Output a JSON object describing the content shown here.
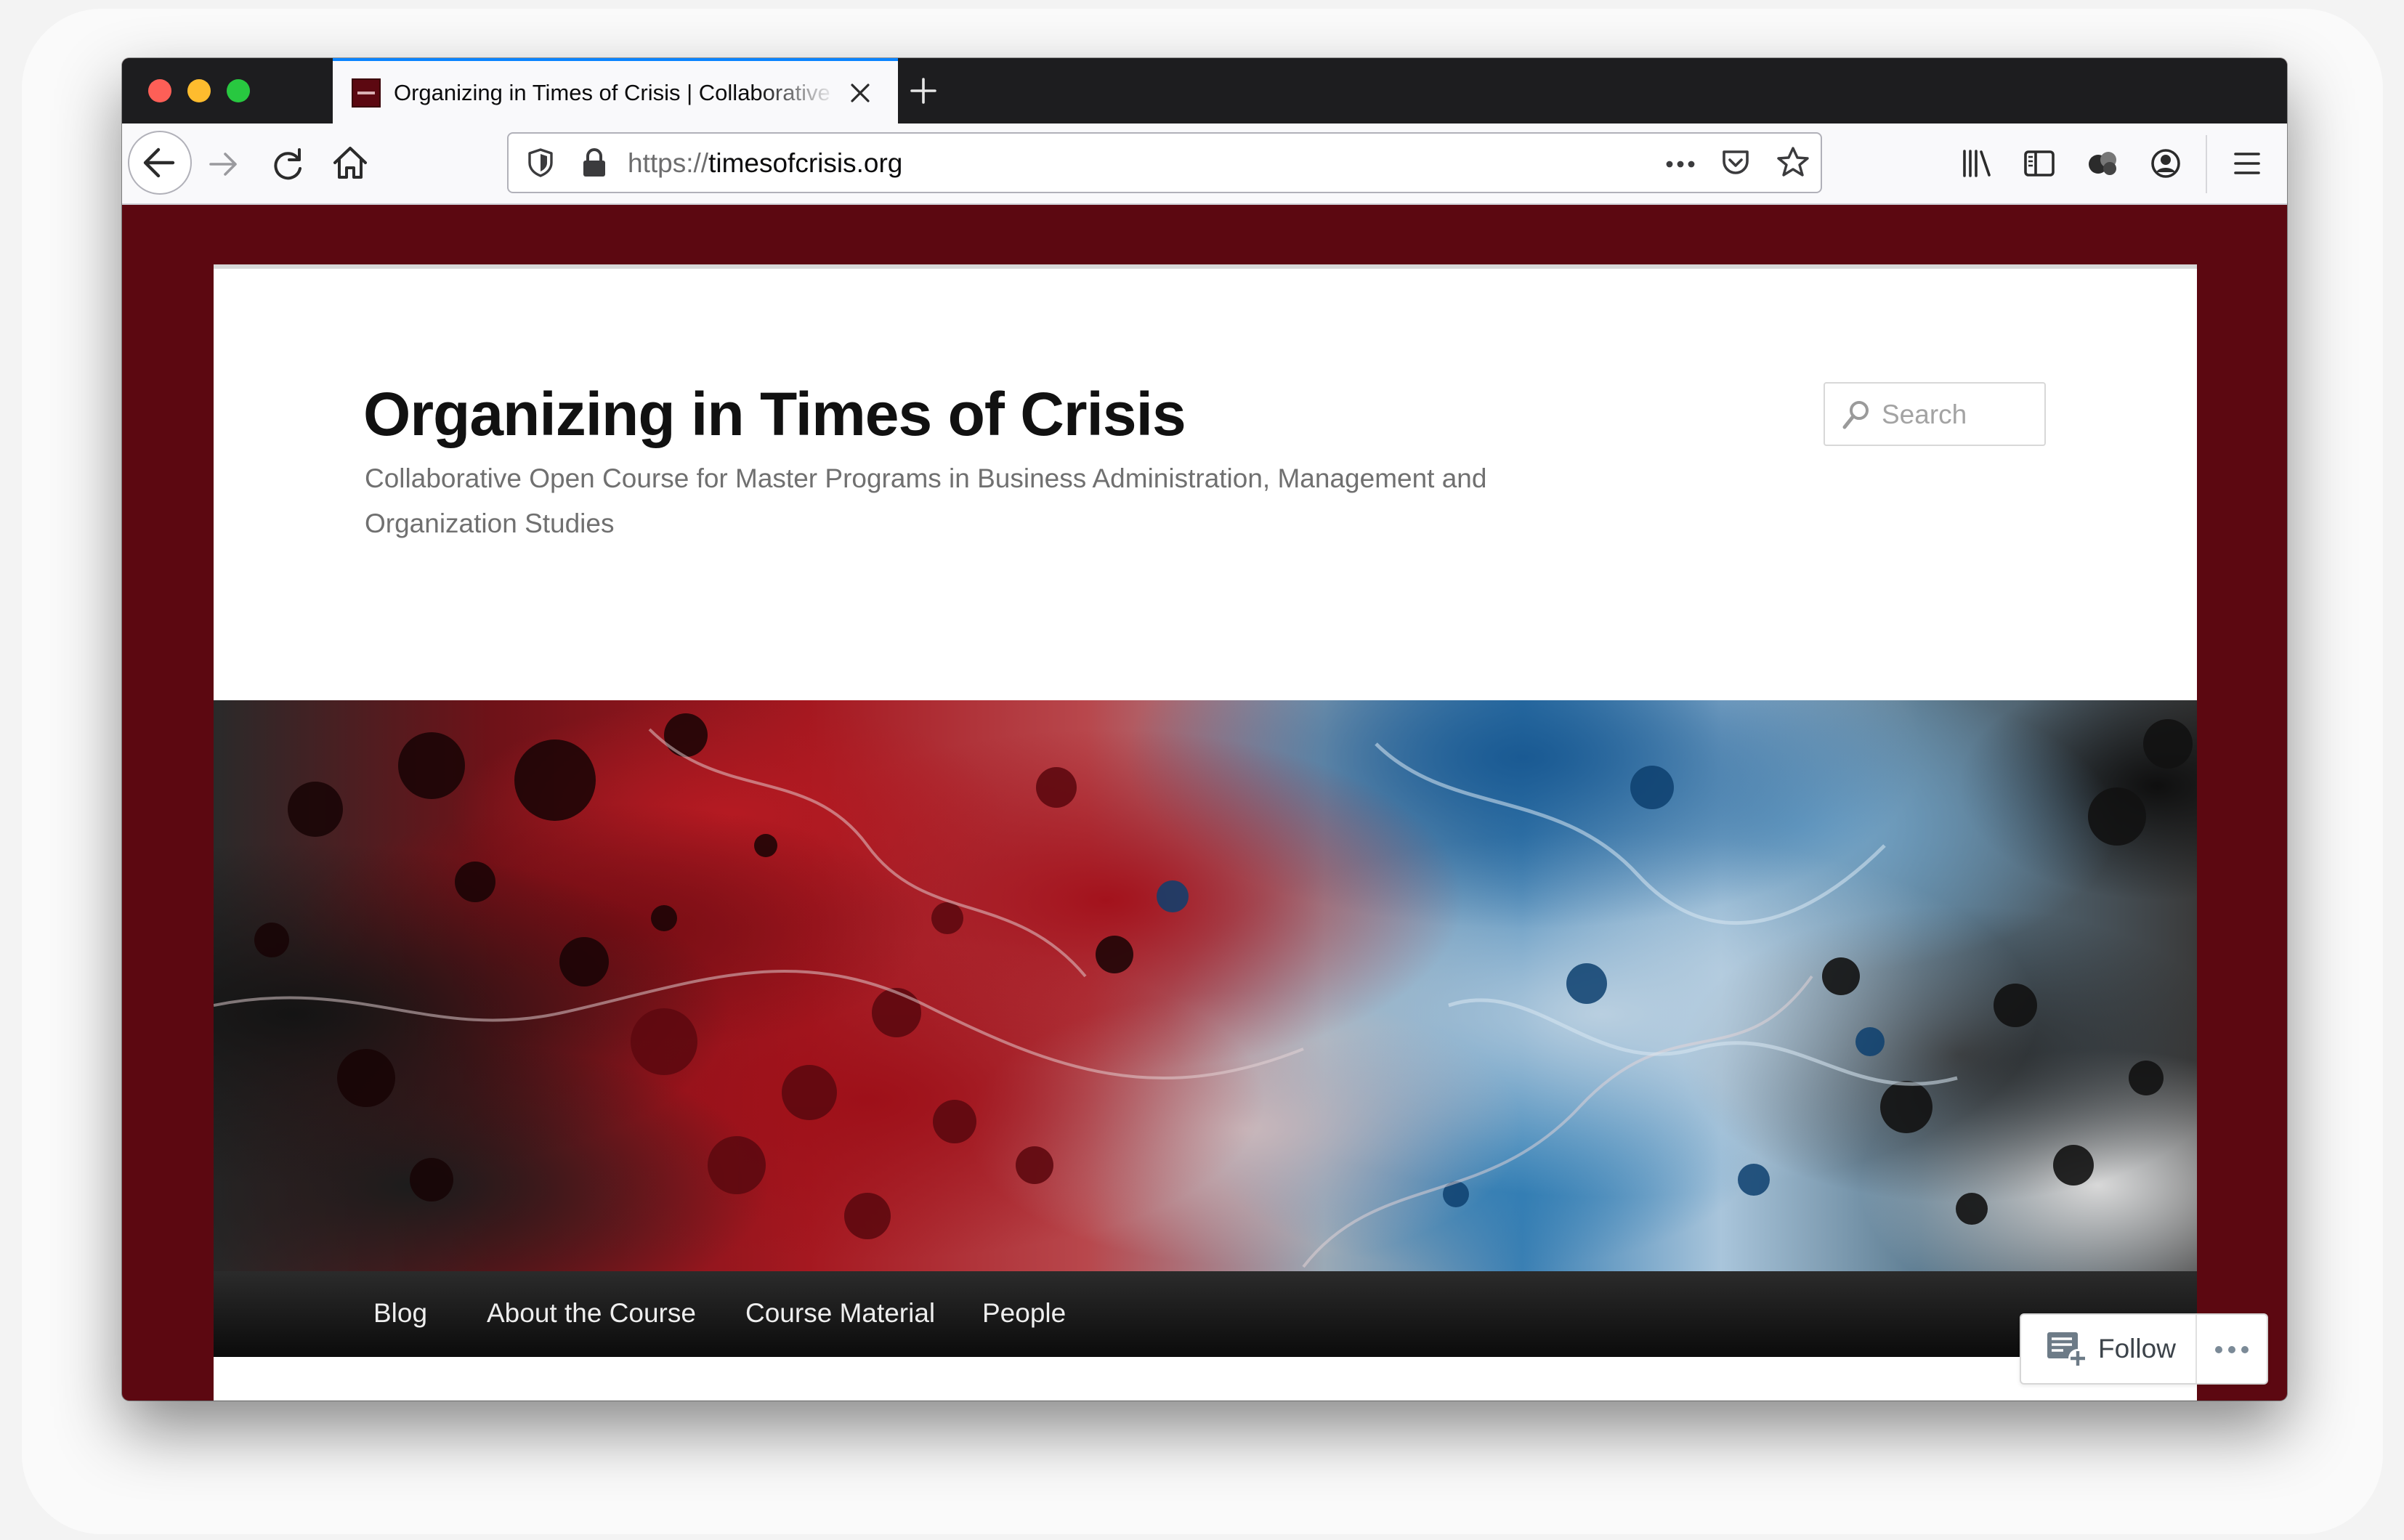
{
  "browser": {
    "tab_title": "Organizing in Times of Crisis | Collaborative Open Course",
    "url_scheme": "https://",
    "url_host": "timesofcrisis.org"
  },
  "site": {
    "title": "Organizing in Times of Crisis",
    "description": "Collaborative Open Course for Master Programs in Business Administration, Management and Organization Studies",
    "search_placeholder": "Search"
  },
  "menu": {
    "items": [
      {
        "label": "Blog"
      },
      {
        "label": "About the Course"
      },
      {
        "label": "Course Material"
      },
      {
        "label": "People"
      }
    ]
  },
  "follow": {
    "label": "Follow"
  },
  "colors": {
    "page_background": "#5c0811",
    "tab_accent": "#0a84ff",
    "nav_bar": "#111111"
  },
  "icons": [
    "back-arrow-icon",
    "forward-arrow-icon",
    "reload-icon",
    "home-icon",
    "shield-icon",
    "lock-icon",
    "more-dots-icon",
    "pocket-icon",
    "bookmark-star-icon",
    "library-icon",
    "sidebar-icon",
    "extensions-icon",
    "account-icon",
    "hamburger-menu-icon",
    "search-icon",
    "follow-icon"
  ]
}
